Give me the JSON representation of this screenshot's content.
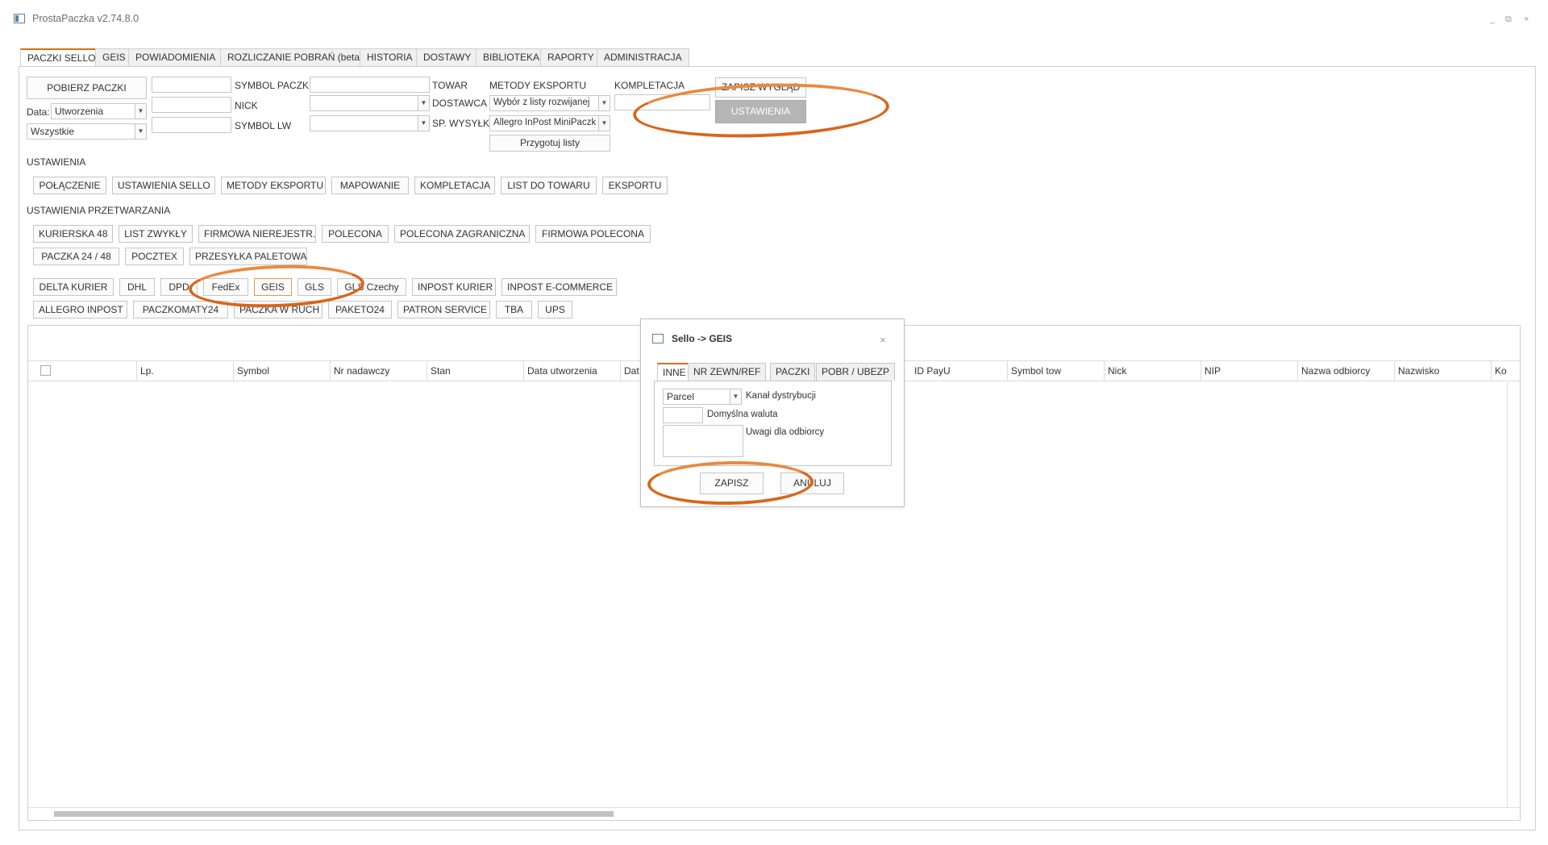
{
  "window": {
    "title": "ProstaPaczka v2.74.8.0",
    "controls": [
      "_",
      "⧉",
      "×"
    ]
  },
  "tabs": [
    {
      "label": "PACZKI SELLO",
      "active": true
    },
    {
      "label": "GEIS"
    },
    {
      "label": "POWIADOMIENIA"
    },
    {
      "label": "ROZLICZANIE POBRAŃ (beta)"
    },
    {
      "label": "HISTORIA"
    },
    {
      "label": "DOSTAWY"
    },
    {
      "label": "BIBLIOTEKA"
    },
    {
      "label": "RAPORTY"
    },
    {
      "label": "ADMINISTRACJA"
    }
  ],
  "toolbar": {
    "fetch_button": "POBIERZ PACZKI",
    "date_label": "Data:",
    "date_value": "Utworzenia",
    "status_value": "Wszystkie",
    "symbol_paczki_label": "SYMBOL PACZKI",
    "nick_label": "NICK",
    "symbol_lw_label": "SYMBOL LW",
    "towar_label": "TOWAR",
    "dostawca_label": "DOSTAWCA",
    "sp_wysylki_label": "SP. WYSYŁKI",
    "metody_eksportu_label": "METODY EKSPORTU",
    "metody_eksportu_value": "Wybór z listy rozwijanej",
    "sp_wysylki_value": "Allegro InPost MiniPaczk",
    "prepare_button": "Przygotuj listy",
    "kompletacja_label": "KOMPLETACJA",
    "save_layout_button": "ZAPISZ WYGLĄD",
    "settings_button": "USTAWIENIA"
  },
  "settings": {
    "title": "USTAWIENIA",
    "buttons": [
      "POŁĄCZENIE",
      "USTAWIENIA SELLO",
      "METODY EKSPORTU",
      "MAPOWANIE",
      "KOMPLETACJA",
      "LIST DO TOWARU",
      "EKSPORTU"
    ]
  },
  "processing": {
    "title": "USTAWIENIA PRZETWARZANIA",
    "row1": [
      "KURIERSKA 48",
      "LIST ZWYKŁY",
      "FIRMOWA NIEREJESTR.",
      "POLECONA",
      "POLECONA ZAGRANICZNA",
      "FIRMOWA POLECONA"
    ],
    "row2": [
      "PACZKA 24 / 48",
      "POCZTEX",
      "PRZESYŁKA PALETOWA"
    ],
    "row3": [
      "DELTA KURIER",
      "DHL",
      "DPD",
      "FedEx",
      "GEIS",
      "GLS",
      "GLS Czechy",
      "INPOST KURIER",
      "INPOST E-COMMERCE"
    ],
    "row4": [
      "ALLEGRO INPOST",
      "PACZKOMATY24",
      "PACZKA W RUCH",
      "PAKETO24",
      "PATRON SERVICE",
      "TBA",
      "UPS"
    ]
  },
  "grid": {
    "columns": [
      "Lp.",
      "Symbol",
      "Nr nadawczy",
      "Stan",
      "Data utworzenia",
      "Dat",
      "ID PayU",
      "Symbol tow",
      "Nick",
      "NIP",
      "Nazwa odbiorcy",
      "Nazwisko",
      "Ko"
    ]
  },
  "dialog": {
    "title": "Sello -> GEIS",
    "close": "×",
    "tabs": [
      "INNE",
      "NR ZEWN/REF",
      "PACZKI",
      "POBR / UBEZP"
    ],
    "channel_value": "Parcel",
    "channel_label": "Kanał dystrybucji",
    "currency_label": "Domyślna waluta",
    "notes_label": "Uwagi dla odbiorcy",
    "save_button": "ZAPISZ",
    "cancel_button": "ANULUJ"
  },
  "colors": {
    "accent": "#e06a10",
    "highlight_ring": "#d9661a"
  }
}
